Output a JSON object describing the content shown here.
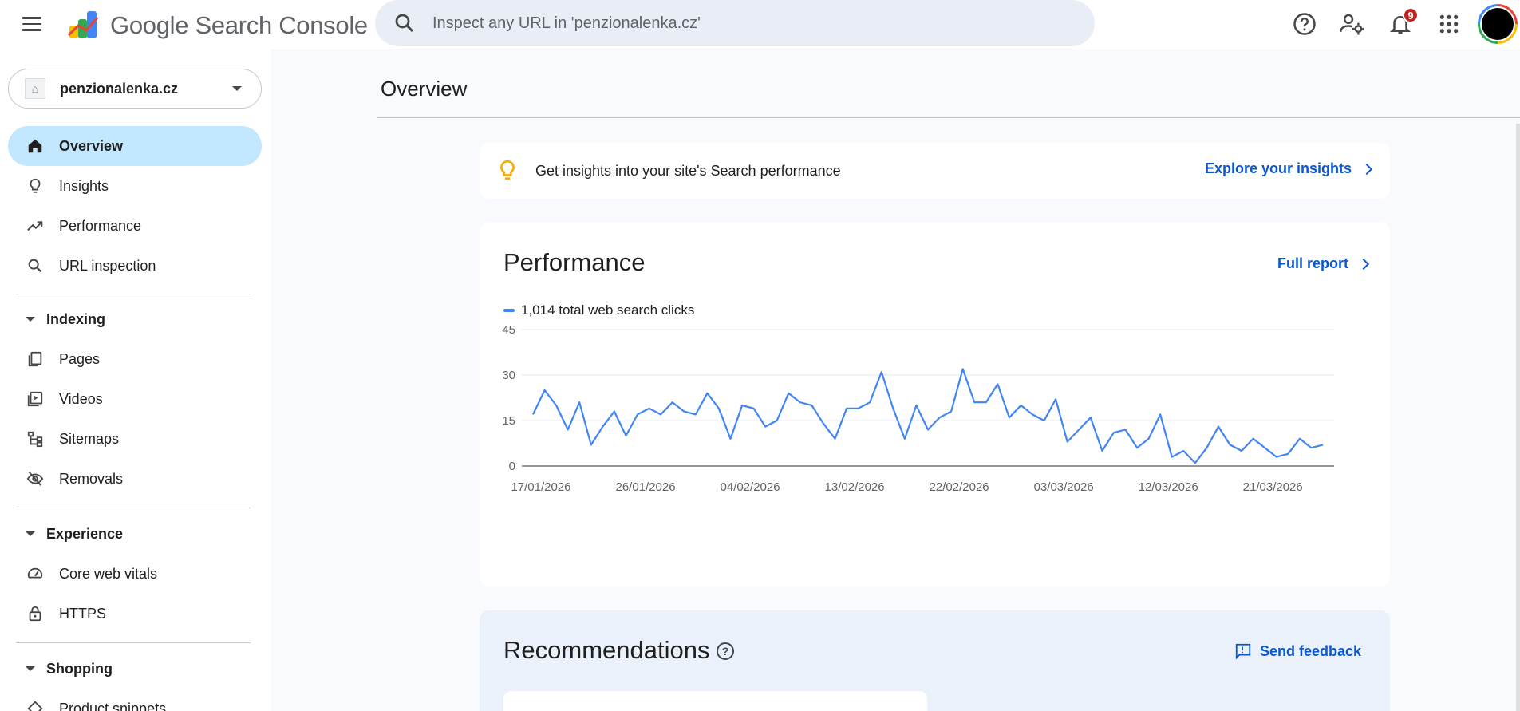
{
  "header": {
    "brand": "Google Search Console",
    "search_placeholder": "Inspect any URL in 'penzionalenka.cz'",
    "notification_count": "9"
  },
  "sidebar": {
    "property": "penzionalenka.cz",
    "items": [
      {
        "label": "Overview",
        "icon": "home-icon",
        "active": true
      },
      {
        "label": "Insights",
        "icon": "lightbulb-icon"
      },
      {
        "label": "Performance",
        "icon": "trending-up-icon"
      },
      {
        "label": "URL inspection",
        "icon": "search-icon"
      }
    ],
    "sections": [
      {
        "label": "Indexing",
        "items": [
          {
            "label": "Pages",
            "icon": "pages-icon"
          },
          {
            "label": "Videos",
            "icon": "video-icon"
          },
          {
            "label": "Sitemaps",
            "icon": "sitemap-icon"
          },
          {
            "label": "Removals",
            "icon": "eye-off-icon"
          }
        ]
      },
      {
        "label": "Experience",
        "items": [
          {
            "label": "Core web vitals",
            "icon": "gauge-icon"
          },
          {
            "label": "HTTPS",
            "icon": "lock-icon"
          }
        ]
      },
      {
        "label": "Shopping",
        "items": [
          {
            "label": "Product snippets",
            "icon": "diamond-icon"
          }
        ]
      }
    ]
  },
  "main": {
    "title": "Overview",
    "insight": {
      "text": "Get insights into your site's Search performance",
      "link": "Explore your insights"
    },
    "performance": {
      "title": "Performance",
      "link": "Full report",
      "legend": "1,014 total web search clicks"
    },
    "recommendations": {
      "title": "Recommendations",
      "help": "?",
      "feedback": "Send feedback"
    }
  },
  "colors": {
    "accent": "#0b57d0",
    "line": "#4285f4",
    "active_nav": "#c2e7ff"
  },
  "chart_data": {
    "type": "line",
    "title": "",
    "xlabel": "",
    "ylabel": "",
    "ylim": [
      0,
      45
    ],
    "yticks": [
      0,
      15,
      30,
      45
    ],
    "xtick_labels": [
      "17/01/2026",
      "26/01/2026",
      "04/02/2026",
      "13/02/2026",
      "22/02/2026",
      "03/03/2026",
      "12/03/2026",
      "21/03/2026"
    ],
    "xtick_index": [
      0,
      9,
      18,
      27,
      36,
      45,
      54,
      63
    ],
    "grid": true,
    "series": [
      {
        "name": "1,014 total web search clicks",
        "color": "#4285f4",
        "values": [
          17,
          25,
          20,
          12,
          21,
          7,
          13,
          18,
          10,
          17,
          19,
          17,
          21,
          18,
          17,
          24,
          19,
          9,
          20,
          19,
          13,
          15,
          24,
          21,
          20,
          14,
          9,
          19,
          19,
          21,
          31,
          19,
          9,
          20,
          12,
          16,
          18,
          32,
          21,
          21,
          27,
          16,
          20,
          17,
          15,
          22,
          8,
          12,
          16,
          5,
          11,
          12,
          6,
          9,
          17,
          3,
          5,
          1,
          6,
          13,
          7,
          5,
          9,
          6,
          3,
          4,
          9,
          6,
          7
        ]
      }
    ]
  }
}
